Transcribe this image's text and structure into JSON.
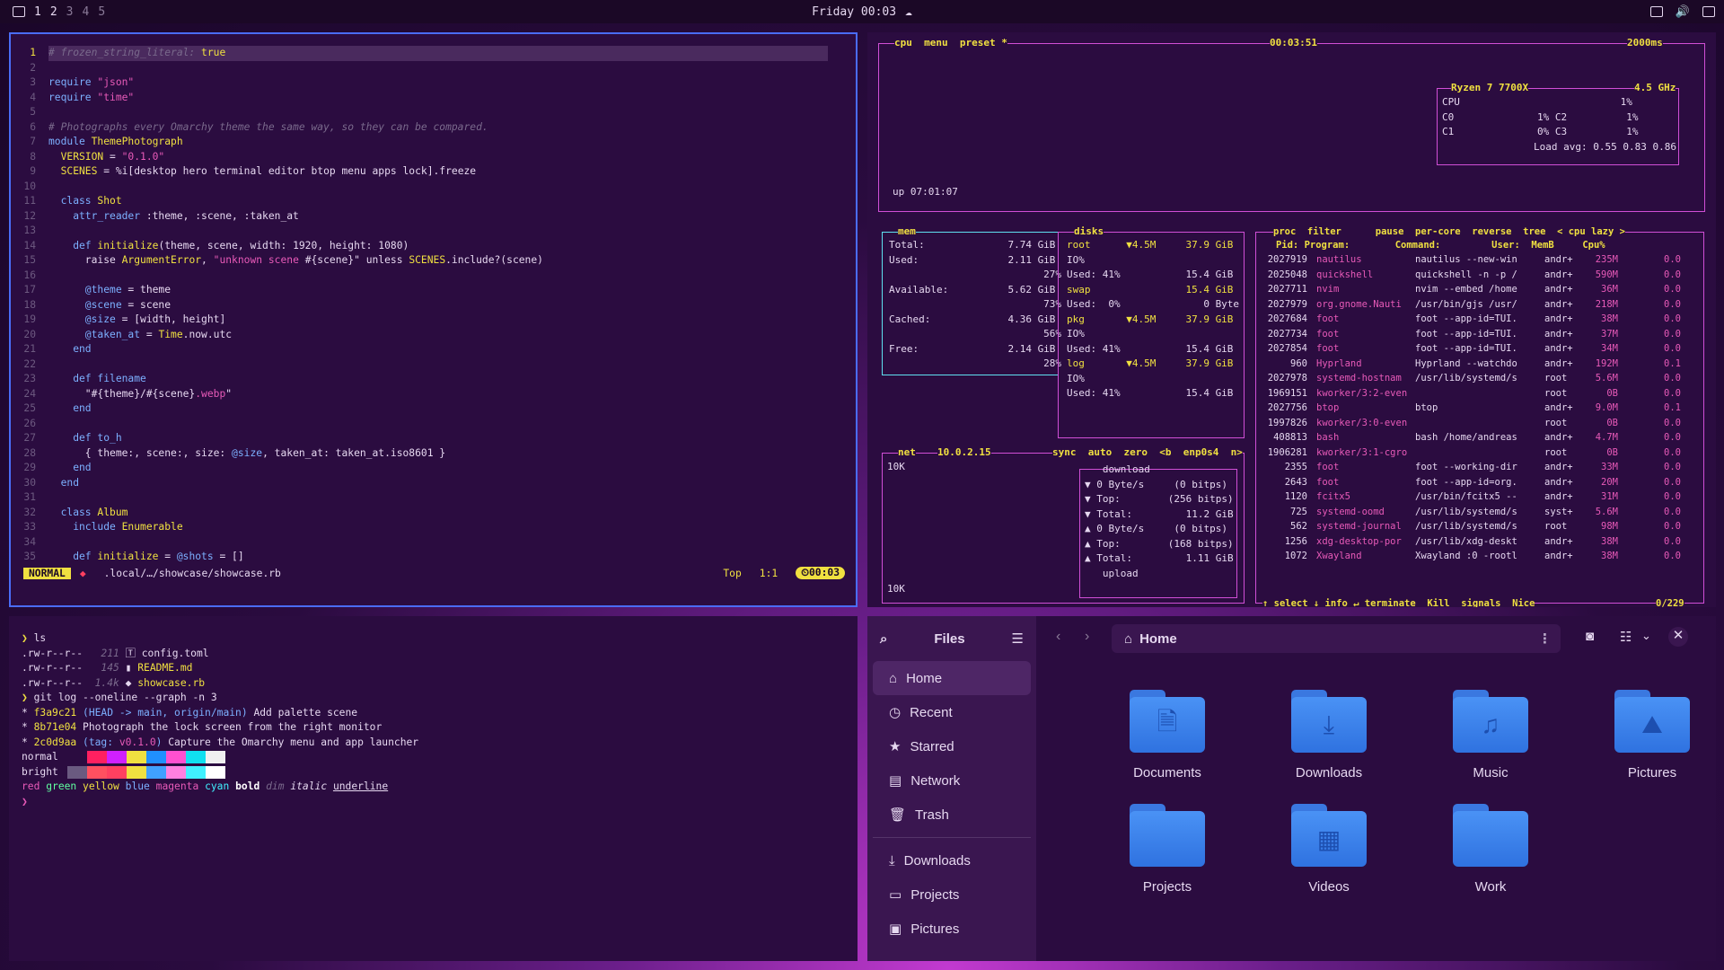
{
  "topbar": {
    "workspaces": [
      "1",
      "2",
      "3",
      "4",
      "5"
    ],
    "clock": "Friday 00:03"
  },
  "editor": {
    "lines": [
      {
        "n": "1",
        "parts": [
          [
            "c",
            "# frozen_string_literal:"
          ],
          [
            "k",
            " true"
          ]
        ]
      },
      {
        "n": "2",
        "parts": []
      },
      {
        "n": "3",
        "parts": [
          [
            "i",
            "require "
          ],
          [
            "s",
            "\"json\""
          ]
        ]
      },
      {
        "n": "4",
        "parts": [
          [
            "i",
            "require "
          ],
          [
            "s",
            "\"time\""
          ]
        ]
      },
      {
        "n": "5",
        "parts": []
      },
      {
        "n": "6",
        "parts": [
          [
            "c",
            "# Photographs every Omarchy theme the same way, so they can be compared."
          ]
        ]
      },
      {
        "n": "7",
        "parts": [
          [
            "i",
            "module "
          ],
          [
            "k",
            "ThemePhotograph"
          ]
        ]
      },
      {
        "n": "8",
        "parts": [
          [
            "k",
            "  VERSION"
          ],
          [
            "t",
            " = "
          ],
          [
            "s",
            "\"0.1.0\""
          ]
        ]
      },
      {
        "n": "9",
        "parts": [
          [
            "k",
            "  SCENES"
          ],
          [
            "t",
            " = %i[desktop hero terminal editor btop menu apps lock].freeze"
          ]
        ]
      },
      {
        "n": "10",
        "parts": []
      },
      {
        "n": "11",
        "parts": [
          [
            "i",
            "  class "
          ],
          [
            "k",
            "Shot"
          ]
        ]
      },
      {
        "n": "12",
        "parts": [
          [
            "i",
            "    attr_reader "
          ],
          [
            "t",
            ":theme, :scene, :taken_at"
          ]
        ]
      },
      {
        "n": "13",
        "parts": []
      },
      {
        "n": "14",
        "parts": [
          [
            "i",
            "    def "
          ],
          [
            "k",
            "initialize"
          ],
          [
            "t",
            "(theme, scene, width: 1920, height: 1080)"
          ]
        ]
      },
      {
        "n": "15",
        "parts": [
          [
            "t",
            "      raise "
          ],
          [
            "k",
            "ArgumentError"
          ],
          [
            "t",
            ", "
          ],
          [
            "s",
            "\"unknown scene "
          ],
          [
            "t",
            "#{scene}\" unless "
          ],
          [
            "k",
            "SCENES"
          ],
          [
            "t",
            ".include?(scene)"
          ]
        ]
      },
      {
        "n": "16",
        "parts": []
      },
      {
        "n": "17",
        "parts": [
          [
            "i",
            "      @theme"
          ],
          [
            "t",
            " = theme"
          ]
        ]
      },
      {
        "n": "18",
        "parts": [
          [
            "i",
            "      @scene"
          ],
          [
            "t",
            " = scene"
          ]
        ]
      },
      {
        "n": "19",
        "parts": [
          [
            "i",
            "      @size"
          ],
          [
            "t",
            " = [width, height]"
          ]
        ]
      },
      {
        "n": "20",
        "parts": [
          [
            "i",
            "      @taken_at"
          ],
          [
            "t",
            " = "
          ],
          [
            "k",
            "Time"
          ],
          [
            "t",
            ".now.utc"
          ]
        ]
      },
      {
        "n": "21",
        "parts": [
          [
            "i",
            "    end"
          ]
        ]
      },
      {
        "n": "22",
        "parts": []
      },
      {
        "n": "23",
        "parts": [
          [
            "i",
            "    def "
          ],
          [
            "i",
            "filename"
          ]
        ]
      },
      {
        "n": "24",
        "parts": [
          [
            "t",
            "      \"#{theme}/#{scene}"
          ],
          [
            "s",
            ".webp"
          ],
          [
            "t",
            "\""
          ]
        ]
      },
      {
        "n": "25",
        "parts": [
          [
            "i",
            "    end"
          ]
        ]
      },
      {
        "n": "26",
        "parts": []
      },
      {
        "n": "27",
        "parts": [
          [
            "i",
            "    def "
          ],
          [
            "i",
            "to_h"
          ]
        ]
      },
      {
        "n": "28",
        "parts": [
          [
            "t",
            "      { theme:, scene:, size: "
          ],
          [
            "i",
            "@size"
          ],
          [
            "t",
            ", taken_at: taken_at.iso8601 }"
          ]
        ]
      },
      {
        "n": "29",
        "parts": [
          [
            "i",
            "    end"
          ]
        ]
      },
      {
        "n": "30",
        "parts": [
          [
            "i",
            "  end"
          ]
        ]
      },
      {
        "n": "31",
        "parts": []
      },
      {
        "n": "32",
        "parts": [
          [
            "i",
            "  class "
          ],
          [
            "k",
            "Album"
          ]
        ]
      },
      {
        "n": "33",
        "parts": [
          [
            "i",
            "    include "
          ],
          [
            "k",
            "Enumerable"
          ]
        ]
      },
      {
        "n": "34",
        "parts": []
      },
      {
        "n": "35",
        "parts": [
          [
            "i",
            "    def "
          ],
          [
            "k",
            "initialize"
          ],
          [
            "t",
            " = "
          ],
          [
            "i",
            "@shots"
          ],
          [
            "t",
            " = []"
          ]
        ]
      }
    ],
    "status": {
      "mode": "NORMAL",
      "path": ".local/…/showcase/showcase.rb",
      "top": "Top",
      "pos": "1:1",
      "clock": "00:03"
    }
  },
  "btop": {
    "cpu": {
      "tabs": "cpu  menu  preset *",
      "time": "00:03:51",
      "interval": "2000ms",
      "model": "Ryzen 7 7700X",
      "freq": "4.5 GHz",
      "uptime": "up 07:01:07",
      "load": "Load avg: 0.55 0.83 0.86",
      "rows": [
        "CPU                           1%",
        "C0              1% C2          1%",
        "C1              0% C3          1%"
      ]
    },
    "mem": {
      "title": "mem",
      "rows": [
        "Total:              7.74 GiB",
        "Used:               2.11 GiB",
        "                          27%",
        "Available:          5.62 GiB",
        "                          73%",
        "Cached:             4.36 GiB",
        "                          56%",
        "Free:               2.14 GiB",
        "                          28%"
      ]
    },
    "disks": {
      "title": "disks",
      "rows": [
        "root      ▼4.5M     37.9 GiB",
        "IO%",
        "Used: 41%           15.4 GiB",
        "swap                15.4 GiB",
        "Used:  0%              0 Byte",
        "pkg       ▼4.5M     37.9 GiB",
        "IO%",
        "Used: 41%           15.4 GiB",
        "log       ▼4.5M     37.9 GiB",
        "IO%",
        "Used: 41%           15.4 GiB"
      ]
    },
    "net": {
      "title": "net",
      "ip": "10.0.2.15",
      "iface": "sync  auto  zero  <b  enp0s4  n>",
      "scale": "10K",
      "rows": [
        "   download",
        "▼ 0 Byte/s     (0 bitps)",
        "▼ Top:        (256 bitps)",
        "▼ Total:         11.2 GiB",
        "",
        "▲ 0 Byte/s     (0 bitps)",
        "▲ Top:        (168 bitps)",
        "▲ Total:         1.11 GiB",
        "   upload"
      ]
    },
    "proc": {
      "tabs": "proc  filter      pause  per-core  reverse  tree  < cpu lazy >",
      "header": "   Pid: Program:        Command:         User:  MemB     Cpu%",
      "rows": [
        [
          "2027919",
          "nautilus",
          "nautilus --new-win",
          "andr+",
          "235M",
          "0.0"
        ],
        [
          "2025048",
          "quickshell",
          "quickshell -n -p /",
          "andr+",
          "590M",
          "0.0"
        ],
        [
          "2027711",
          "nvim",
          "nvim --embed /home",
          "andr+",
          "36M",
          "0.0"
        ],
        [
          "2027979",
          "org.gnome.Nauti",
          "/usr/bin/gjs /usr/",
          "andr+",
          "218M",
          "0.0"
        ],
        [
          "2027684",
          "foot",
          "foot --app-id=TUI.",
          "andr+",
          "38M",
          "0.0"
        ],
        [
          "2027734",
          "foot",
          "foot --app-id=TUI.",
          "andr+",
          "37M",
          "0.0"
        ],
        [
          "2027854",
          "foot",
          "foot --app-id=TUI.",
          "andr+",
          "34M",
          "0.0"
        ],
        [
          "960",
          "Hyprland",
          "Hyprland --watchdo",
          "andr+",
          "192M",
          "0.1"
        ],
        [
          "2027978",
          "systemd-hostnam",
          "/usr/lib/systemd/s",
          "root",
          "5.6M",
          "0.0"
        ],
        [
          "1969151",
          "kworker/3:2-even",
          "",
          "root",
          "0B",
          "0.0"
        ],
        [
          "2027756",
          "btop",
          "btop",
          "andr+",
          "9.0M",
          "0.1"
        ],
        [
          "1997826",
          "kworker/3:0-even",
          "",
          "root",
          "0B",
          "0.0"
        ],
        [
          "408813",
          "bash",
          "bash /home/andreas",
          "andr+",
          "4.7M",
          "0.0"
        ],
        [
          "1906281",
          "kworker/3:1-cgro",
          "",
          "root",
          "0B",
          "0.0"
        ],
        [
          "2355",
          "foot",
          "foot --working-dir",
          "andr+",
          "33M",
          "0.0"
        ],
        [
          "2643",
          "foot",
          "foot --app-id=org.",
          "andr+",
          "20M",
          "0.0"
        ],
        [
          "1120",
          "fcitx5",
          "/usr/bin/fcitx5 --",
          "andr+",
          "31M",
          "0.0"
        ],
        [
          "725",
          "systemd-oomd",
          "/usr/lib/systemd/s",
          "syst+",
          "5.6M",
          "0.0"
        ],
        [
          "562",
          "systemd-journal",
          "/usr/lib/systemd/s",
          "root",
          "98M",
          "0.0"
        ],
        [
          "1256",
          "xdg-desktop-por",
          "/usr/lib/xdg-deskt",
          "andr+",
          "38M",
          "0.0"
        ],
        [
          "1072",
          "Xwayland",
          "Xwayland :0 -rootl",
          "andr+",
          "38M",
          "0.0"
        ]
      ],
      "footer": "↑ select ↓ info ↵ terminate  Kill  signals  Nice",
      "count": "0/229"
    }
  },
  "terminal": {
    "lines": [
      [
        [
          "k",
          "❯ "
        ],
        [
          "t",
          "ls"
        ]
      ],
      [
        [
          "t",
          ".rw-r--r--   "
        ],
        [
          "c",
          "211"
        ],
        [
          "t",
          " 🅃 config.toml"
        ]
      ],
      [
        [
          "t",
          ".rw-r--r--   "
        ],
        [
          "c",
          "145"
        ],
        [
          "t",
          " ▮ "
        ],
        [
          "k",
          "README.md"
        ]
      ],
      [
        [
          "t",
          ".rw-r--r--  "
        ],
        [
          "c",
          "1.4k"
        ],
        [
          "t",
          " ◆ "
        ],
        [
          "k",
          "showcase.rb"
        ]
      ],
      [
        [
          "k",
          "❯ "
        ],
        [
          "t",
          "git log --oneline --graph -n 3"
        ]
      ],
      [
        [
          "t",
          "* "
        ],
        [
          "k",
          "f3a9c21"
        ],
        [
          "i",
          " (HEAD -> main, origin/main)"
        ],
        [
          "t",
          " Add palette scene"
        ]
      ],
      [
        [
          "t",
          "* "
        ],
        [
          "k",
          "8b71e04"
        ],
        [
          "t",
          " Photograph the lock screen from the right monitor"
        ]
      ],
      [
        [
          "t",
          "* "
        ],
        [
          "k",
          "2c0d9aa"
        ],
        [
          "i",
          " (tag: "
        ],
        [
          "s",
          "v0.1.0"
        ],
        [
          "i",
          ")"
        ],
        [
          "t",
          " Capture the Omarchy menu and app launcher"
        ]
      ],
      [
        [
          "t",
          "normal"
        ]
      ],
      [
        [
          "t",
          "bright"
        ]
      ],
      [
        [
          "s",
          "red "
        ],
        [
          "grn",
          "green "
        ],
        [
          "k",
          "yellow "
        ],
        [
          "i",
          "blue "
        ],
        [
          "s",
          "magenta "
        ],
        [
          "cy",
          "cyan "
        ],
        [
          "b",
          "bold "
        ],
        [
          "c",
          "dim "
        ],
        [
          "it",
          "italic "
        ],
        [
          "u",
          "underline"
        ]
      ],
      [
        [
          "s",
          "❯"
        ]
      ]
    ],
    "palette_normal": [
      "#2b0c40",
      "#ff2060",
      "#d020ff",
      "#f0e040",
      "#2090ff",
      "#ff50d0",
      "#10e0f0",
      "#f0f0f0"
    ],
    "palette_bright": [
      "#6a5a80",
      "#ff5060",
      "#ff4060",
      "#f0e040",
      "#40a0ff",
      "#ff80e0",
      "#40f0ff",
      "#ffffff"
    ]
  },
  "files": {
    "title": "Files",
    "location": "Home",
    "sidebar": [
      "Home",
      "Recent",
      "Starred",
      "Network",
      "Trash"
    ],
    "bookmarks": [
      "Downloads",
      "Projects",
      "Pictures"
    ],
    "items": [
      {
        "name": "Documents",
        "icon": "document-icon",
        "glyph": "🗎"
      },
      {
        "name": "Downloads",
        "icon": "download-icon",
        "glyph": "⤓"
      },
      {
        "name": "Music",
        "icon": "music-icon",
        "glyph": "♫"
      },
      {
        "name": "Pictures",
        "icon": "picture-icon",
        "glyph": "⛰"
      },
      {
        "name": "Projects",
        "icon": "folder-icon",
        "glyph": ""
      },
      {
        "name": "Videos",
        "icon": "video-icon",
        "glyph": "▦"
      },
      {
        "name": "Work",
        "icon": "folder-icon",
        "glyph": ""
      }
    ]
  }
}
